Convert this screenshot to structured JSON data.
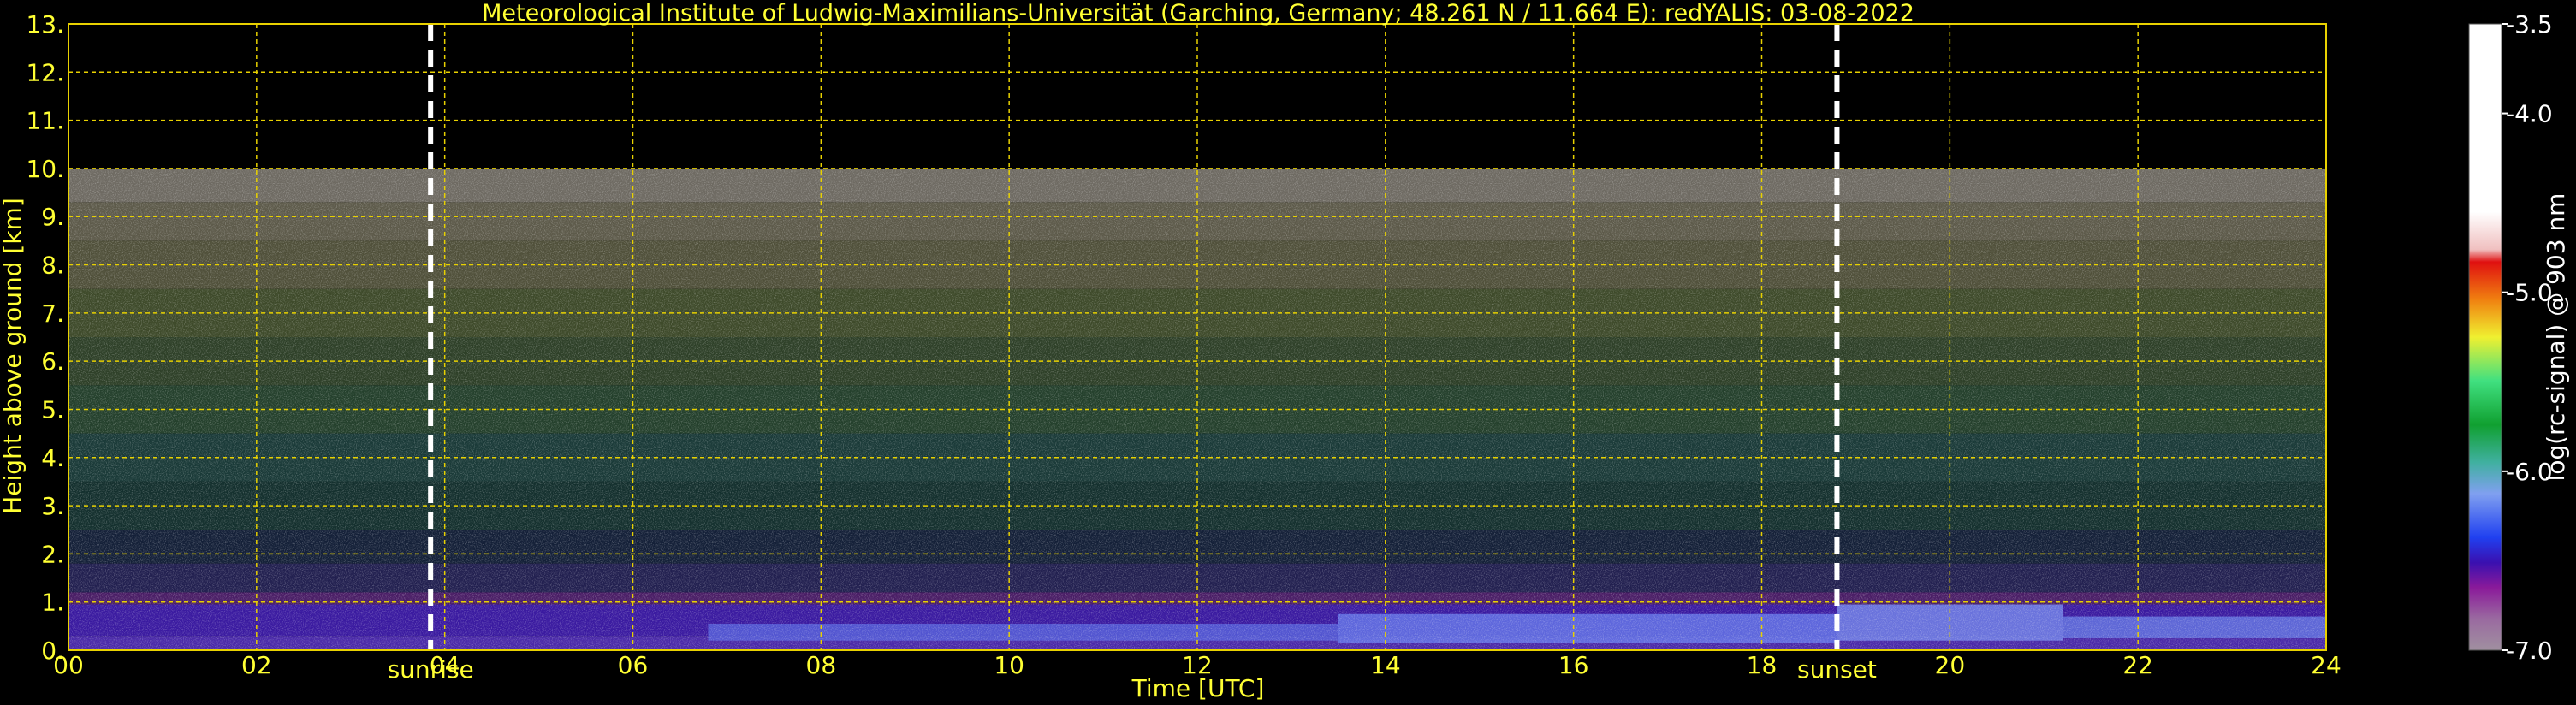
{
  "chart_data": {
    "type": "heatmap",
    "title": "Meteorological Institute of Ludwig-Maximilians-Universität (Garching, Germany; 48.261 N / 11.664 E):    redYALIS: 03-08-2022",
    "xlabel": "Time [UTC]",
    "ylabel": "Height above ground [km]",
    "xlim": [
      0,
      24
    ],
    "ylim": [
      0,
      13
    ],
    "x_ticks": [
      "00",
      "02",
      "04",
      "06",
      "08",
      "10",
      "12",
      "14",
      "16",
      "18",
      "20",
      "22",
      "24"
    ],
    "y_ticks": [
      "0.",
      "1.",
      "2.",
      "3.",
      "4.",
      "5.",
      "6.",
      "7.",
      "8.",
      "9.",
      "10.",
      "11.",
      "12.",
      "13."
    ],
    "data_top_km": 10,
    "grid": true,
    "events": [
      {
        "label": "sunrise",
        "time_h": 3.85
      },
      {
        "label": "sunset",
        "time_h": 18.8
      }
    ],
    "colorbar": {
      "label": "log(rc-signal) @ 903 nm",
      "range": [
        -7.0,
        -3.5
      ],
      "tick_labels": [
        "-3.5",
        "-4.0",
        "-5.0",
        "-6.0",
        "-7.0"
      ],
      "tick_values": [
        -3.5,
        -4.0,
        -5.0,
        -6.0,
        -7.0
      ]
    }
  }
}
